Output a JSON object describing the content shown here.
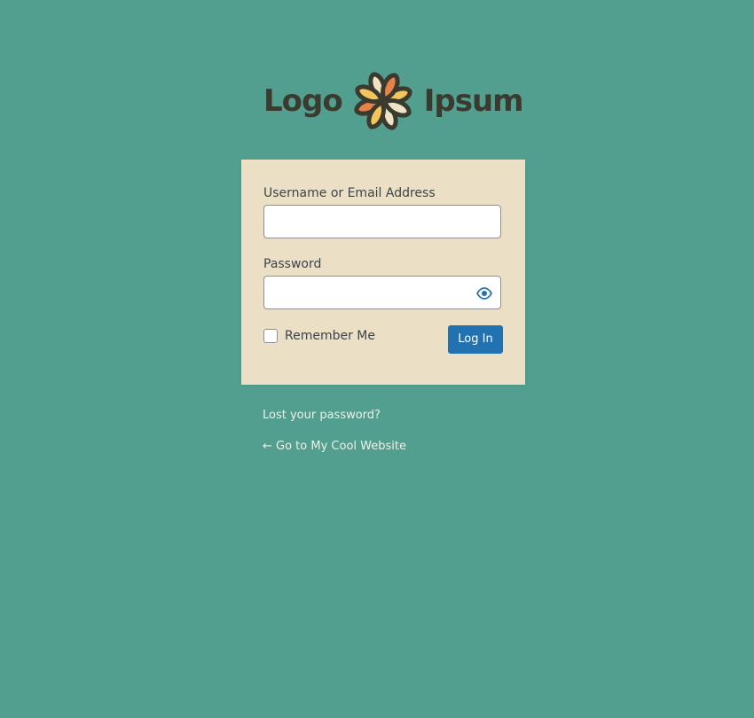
{
  "colors": {
    "page_background": "#529e8f",
    "card_background": "#ebe0c6",
    "button_primary": "#2271b1",
    "link_text": "#f0f0e6",
    "logo_text": "#3a3a2e",
    "logo_petal_orange": "#e6824a",
    "logo_petal_yellow": "#f3c55d",
    "logo_petal_cream": "#eee3c7",
    "eye_icon": "#2271b1"
  },
  "logo": {
    "text_left": "Logo",
    "text_right": "Ipsum"
  },
  "form": {
    "username_label": "Username or Email Address",
    "username_value": "",
    "password_label": "Password",
    "password_value": "",
    "show_password_icon": "eye-icon",
    "remember_label": "Remember Me",
    "remember_checked": false,
    "login_button_label": "Log In"
  },
  "links": {
    "lost_password": "Lost your password?",
    "back_to_site": "← Go to My Cool Website"
  }
}
